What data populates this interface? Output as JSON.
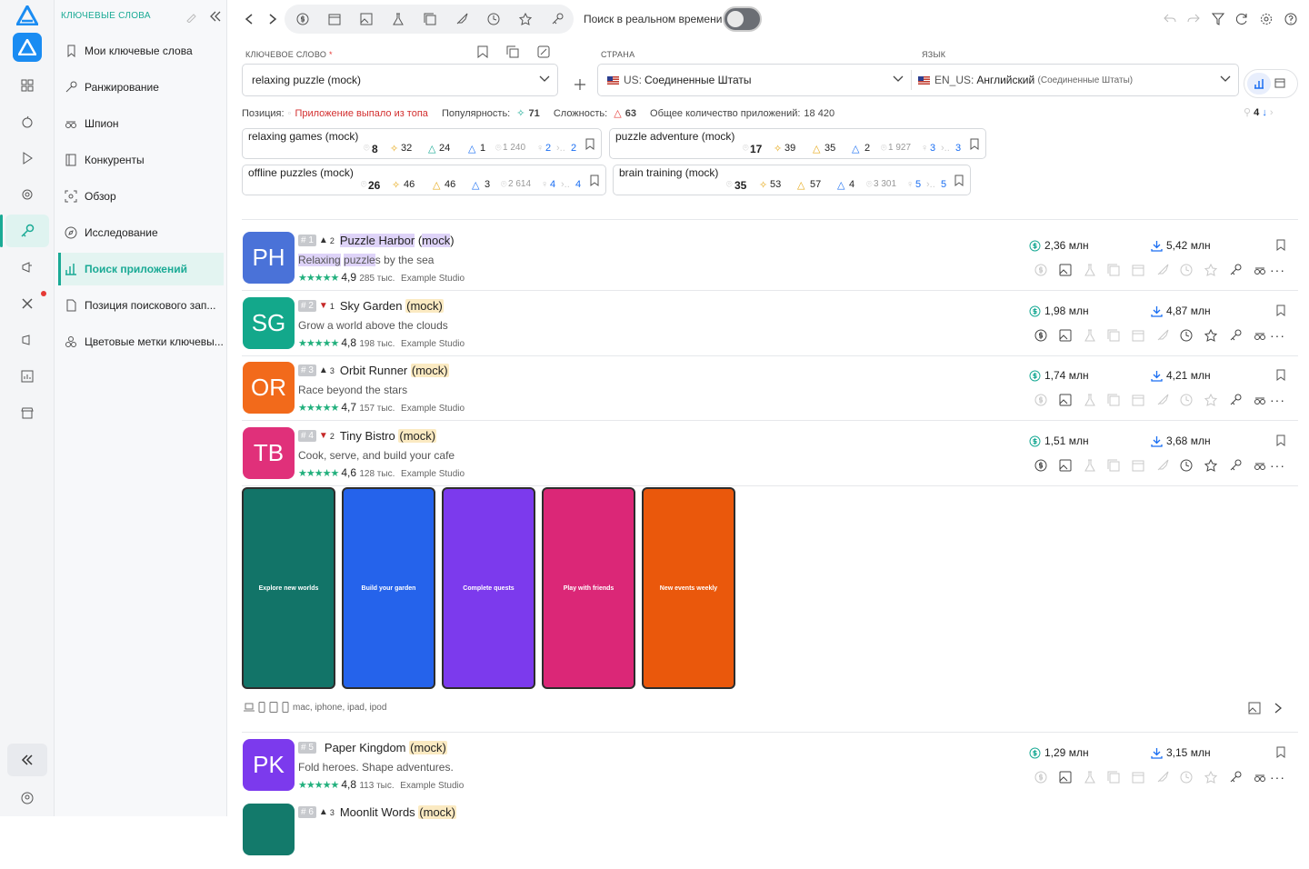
{
  "sidebar_title": "КЛЮЧЕВЫЕ СЛОВА",
  "menu": [
    "Мои ключевые слова",
    "Ранжирование",
    "Шпион",
    "Конкуренты",
    "Обзор",
    "Исследование",
    "Поиск приложений",
    "Позиция поискового зап...",
    "Цветовые метки ключевы..."
  ],
  "realtime_label": "Поиск в реальном времени",
  "keyword_label": "КЛЮЧЕВОЕ СЛОВО",
  "required_mark": "*",
  "keyword_value": "relaxing puzzle (mock)",
  "country_label": "СТРАНА",
  "country_code": "US:",
  "country_value": "Соединенные Штаты",
  "language_label": "ЯЗЫК",
  "language_code": "EN_US:",
  "language_value": "Английский",
  "language_extra": "(Соединенные Штаты)",
  "stats": {
    "position_label": "Позиция:",
    "position_value": "Приложение выпало из топа",
    "popularity_label": "Популярность:",
    "popularity_value": "71",
    "difficulty_label": "Сложность:",
    "difficulty_value": "63",
    "total_label": "Общее количество приложений:",
    "total_value": "18 420",
    "page": "4"
  },
  "related": [
    {
      "name": "relaxing games (mock)",
      "a": "8",
      "b": "32",
      "c": "24",
      "d": "1",
      "e": "1 240",
      "f": "2",
      "g": "2"
    },
    {
      "name": "puzzle adventure (mock)",
      "a": "17",
      "b": "39",
      "c": "35",
      "d": "2",
      "e": "1 927",
      "f": "3",
      "g": "3"
    },
    {
      "name": "offline puzzles (mock)",
      "a": "26",
      "b": "46",
      "c": "46",
      "d": "3",
      "e": "2 614",
      "f": "4",
      "g": "4"
    },
    {
      "name": "brain training (mock)",
      "a": "35",
      "b": "53",
      "c": "57",
      "d": "4",
      "e": "3 301",
      "f": "5",
      "g": "5"
    }
  ],
  "apps": [
    {
      "initials": "PH",
      "color": "#4a72d8",
      "rank": "# 1",
      "dir": "up",
      "move": "2",
      "name": "Puzzle Harbor",
      "mock": "(mock)",
      "sub": "by the sea",
      "sub_hl1": "Relaxing",
      "sub_hl2": "puzzle",
      "sub_s": "s",
      "rating": "4,9",
      "reviews": "285 тыс.",
      "dev": "Example Studio",
      "revenue": "2,36 млн",
      "downloads": "5,42 млн"
    },
    {
      "initials": "SG",
      "color": "#13a88b",
      "rank": "# 2",
      "dir": "down",
      "move": "1",
      "name": "Sky Garden",
      "mock": "(mock)",
      "sub": "Grow a world above the clouds",
      "rating": "4,8",
      "reviews": "198 тыс.",
      "dev": "Example Studio",
      "revenue": "1,98 млн",
      "downloads": "4,87 млн"
    },
    {
      "initials": "OR",
      "color": "#f26a1b",
      "rank": "# 3",
      "dir": "up",
      "move": "3",
      "name": "Orbit Runner",
      "mock": "(mock)",
      "sub": "Race beyond the stars",
      "rating": "4,7",
      "reviews": "157 тыс.",
      "dev": "Example Studio",
      "revenue": "1,74 млн",
      "downloads": "4,21 млн"
    },
    {
      "initials": "TB",
      "color": "#e0307a",
      "rank": "# 4",
      "dir": "down",
      "move": "2",
      "name": "Tiny Bistro",
      "mock": "(mock)",
      "sub": "Cook, serve, and build your cafe",
      "rating": "4,6",
      "reviews": "128 тыс.",
      "dev": "Example Studio",
      "revenue": "1,51 млн",
      "downloads": "3,68 млн"
    },
    {
      "initials": "PK",
      "color": "#7c3aed",
      "rank": "# 5",
      "dir": "",
      "move": "",
      "name": "Paper Kingdom",
      "mock": "(mock)",
      "sub": "Fold heroes. Shape adventures.",
      "rating": "4,8",
      "reviews": "113 тыс.",
      "dev": "Example Studio",
      "revenue": "1,29 млн",
      "downloads": "3,15 млн"
    },
    {
      "initials": "",
      "color": "#137a6b",
      "rank": "# 6",
      "dir": "up",
      "move": "3",
      "name": "Moonlit Words",
      "mock": "(mock)",
      "sub": "",
      "rating": "",
      "reviews": "",
      "dev": "",
      "revenue": "",
      "downloads": ""
    }
  ],
  "screenshots": [
    "Explore new worlds",
    "Build your garden",
    "Complete quests",
    "Play with friends",
    "New events weekly"
  ],
  "screenshot_colors": [
    "#127468",
    "#2563eb",
    "#7c3aed",
    "#db2777",
    "#ea580c"
  ],
  "platforms": "mac, iphone, ipad, ipod"
}
